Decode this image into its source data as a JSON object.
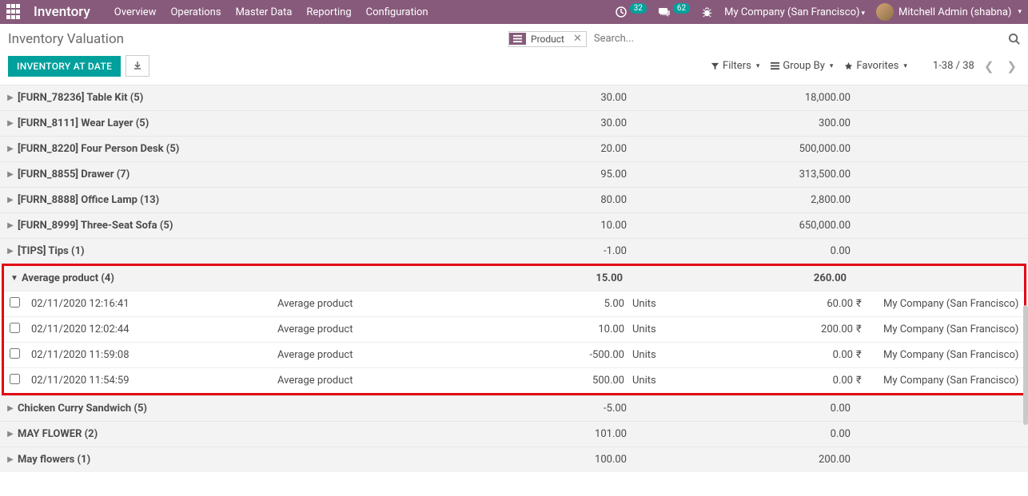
{
  "nav": {
    "app_title": "Inventory",
    "links": [
      "Overview",
      "Operations",
      "Master Data",
      "Reporting",
      "Configuration"
    ],
    "clock_badge": "32",
    "chat_badge": "62",
    "company": "My Company (San Francisco)",
    "user": "Mitchell Admin (shabna)"
  },
  "breadcrumb": {
    "title": "Inventory Valuation",
    "search_tag": "Product",
    "search_placeholder": "Search..."
  },
  "actions": {
    "primary_button": "INVENTORY AT DATE",
    "filters": "Filters",
    "group_by": "Group By",
    "favorites": "Favorites",
    "pager": "1-38 / 38"
  },
  "groups": [
    {
      "label": "[FURN_78236] Table Kit (5)",
      "qty": "30.00",
      "val": "18,000.00"
    },
    {
      "label": "[FURN_8111] Wear Layer (5)",
      "qty": "30.00",
      "val": "300.00"
    },
    {
      "label": "[FURN_8220] Four Person Desk (5)",
      "qty": "20.00",
      "val": "500,000.00"
    },
    {
      "label": "[FURN_8855] Drawer (7)",
      "qty": "95.00",
      "val": "313,500.00"
    },
    {
      "label": "[FURN_8888] Office Lamp (13)",
      "qty": "80.00",
      "val": "2,800.00"
    },
    {
      "label": "[FURN_8999] Three-Seat Sofa (5)",
      "qty": "10.00",
      "val": "650,000.00"
    },
    {
      "label": "[TIPS] Tips (1)",
      "qty": "-1.00",
      "val": "0.00"
    }
  ],
  "expanded": {
    "label": "Average product (4)",
    "qty": "15.00",
    "val": "260.00",
    "rows": [
      {
        "date": "02/11/2020 12:16:41",
        "product": "Average product",
        "qty": "5.00",
        "unit": "Units",
        "amount": "60.00",
        "currency": "₹",
        "company": "My Company (San Francisco)"
      },
      {
        "date": "02/11/2020 12:02:44",
        "product": "Average product",
        "qty": "10.00",
        "unit": "Units",
        "amount": "200.00",
        "currency": "₹",
        "company": "My Company (San Francisco)"
      },
      {
        "date": "02/11/2020 11:59:08",
        "product": "Average product",
        "qty": "-500.00",
        "unit": "Units",
        "amount": "0.00",
        "currency": "₹",
        "company": "My Company (San Francisco)"
      },
      {
        "date": "02/11/2020 11:54:59",
        "product": "Average product",
        "qty": "500.00",
        "unit": "Units",
        "amount": "0.00",
        "currency": "₹",
        "company": "My Company (San Francisco)"
      }
    ]
  },
  "groups_after": [
    {
      "label": "Chicken Curry Sandwich (5)",
      "qty": "-5.00",
      "val": "0.00"
    },
    {
      "label": "MAY FLOWER (2)",
      "qty": "101.00",
      "val": "0.00"
    },
    {
      "label": "May flowers (1)",
      "qty": "100.00",
      "val": "200.00"
    }
  ]
}
